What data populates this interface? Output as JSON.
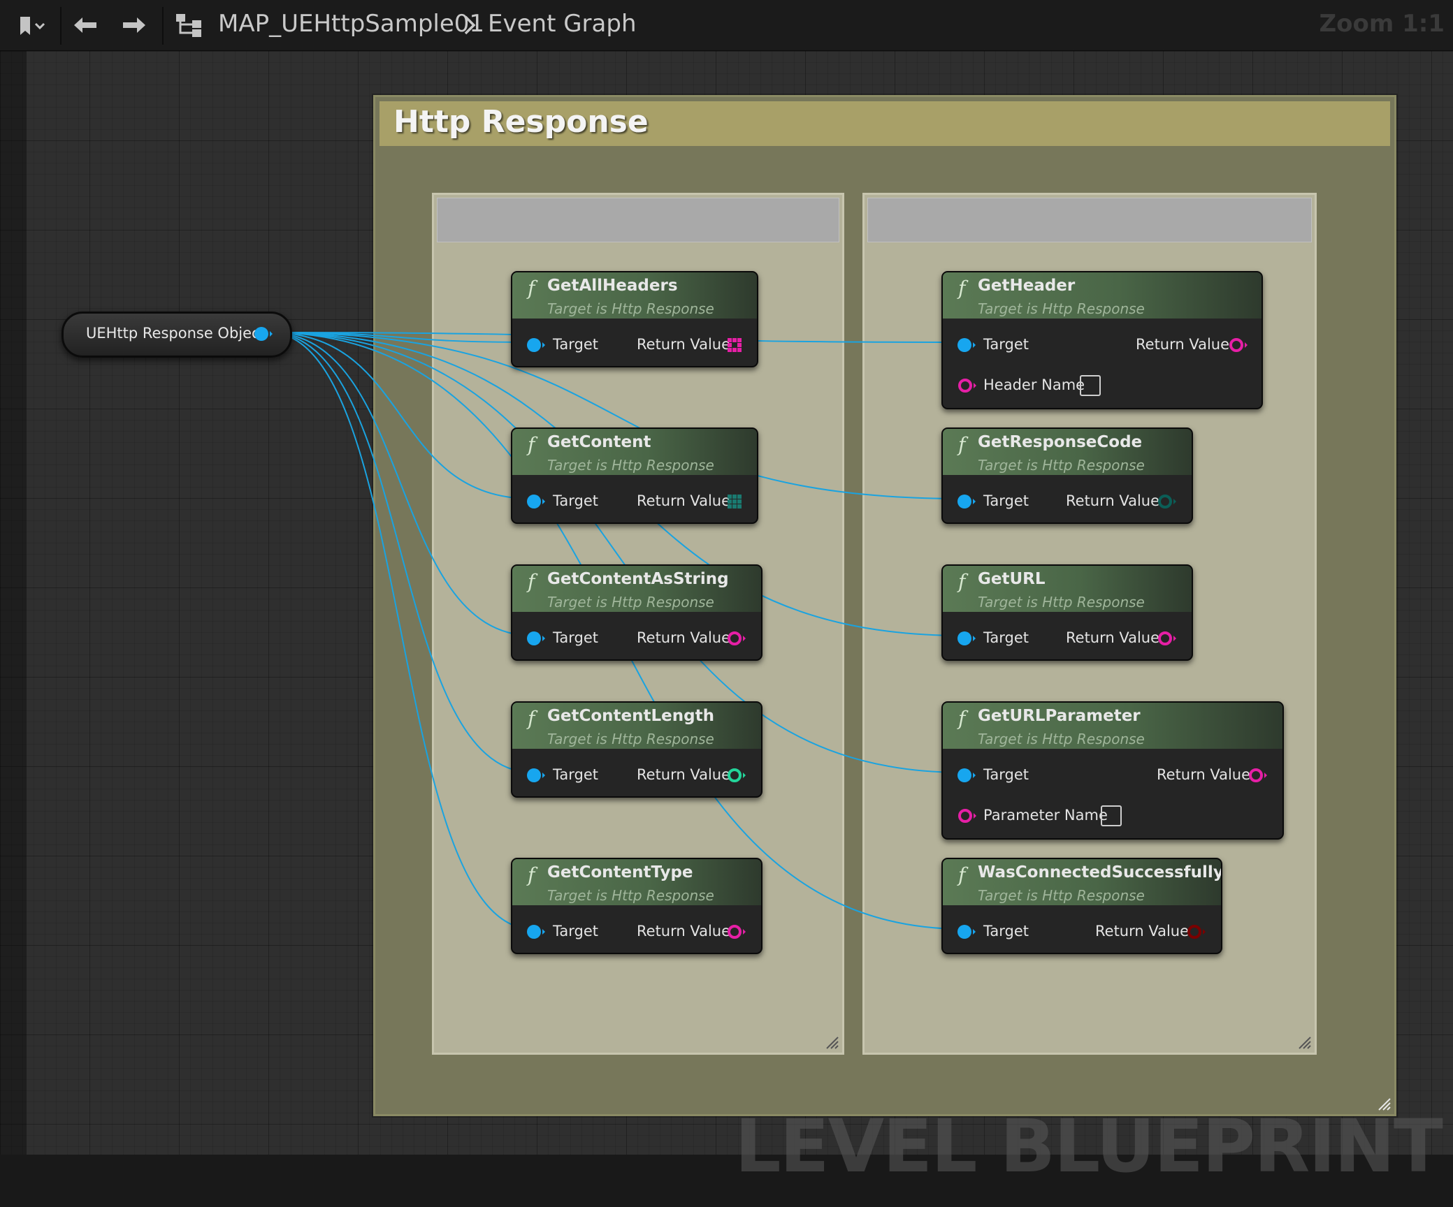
{
  "toolbar": {
    "breadcrumb_asset": "MAP_UEHttpSample01",
    "breadcrumb_graph": "Event Graph",
    "zoom": "Zoom 1:1"
  },
  "canvas": {
    "watermark": "LEVEL BLUEPRINT",
    "comment_title": "Http Response",
    "variable_node": "UEHttp Response Object"
  },
  "pin_labels": {
    "target": "Target",
    "return_value": "Return Value"
  },
  "nodes": {
    "get_all_headers": {
      "title": "GetAllHeaders",
      "subtitle": "Target is Http Response",
      "return_color": "#e61fa6"
    },
    "get_content": {
      "title": "GetContent",
      "subtitle": "Target is Http Response",
      "return_color": "#1a7a70"
    },
    "get_content_as_string": {
      "title": "GetContentAsString",
      "subtitle": "Target is Http Response",
      "return_color": "#e61fa6"
    },
    "get_content_length": {
      "title": "GetContentLength",
      "subtitle": "Target is Http Response",
      "return_color": "#23d59a"
    },
    "get_content_type": {
      "title": "GetContentType",
      "subtitle": "Target is Http Response",
      "return_color": "#e61fa6"
    },
    "get_header": {
      "title": "GetHeader",
      "subtitle": "Target is Http Response",
      "extra_input": "Header Name",
      "return_color": "#e61fa6"
    },
    "get_response_code": {
      "title": "GetResponseCode",
      "subtitle": "Target is Http Response",
      "return_color": "#0b5e57"
    },
    "get_url": {
      "title": "GetURL",
      "subtitle": "Target is Http Response",
      "return_color": "#e61fa6"
    },
    "get_url_parameter": {
      "title": "GetURLParameter",
      "subtitle": "Target is Http Response",
      "extra_input": "Parameter Name",
      "return_color": "#e61fa6"
    },
    "was_connected_successfully": {
      "title": "WasConnectedSuccessfully",
      "subtitle": "Target is Http Response",
      "return_color": "#7a0000"
    }
  },
  "colors": {
    "object_pin": "#17a6ef",
    "wire": "#1aa3e0",
    "comment": "#a8a068"
  }
}
